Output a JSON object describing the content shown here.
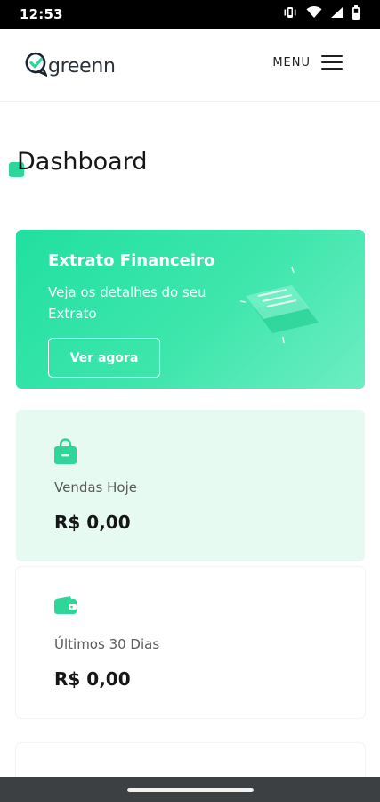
{
  "status_bar": {
    "time": "12:53",
    "icons": [
      "vibrate-icon",
      "wifi-icon",
      "signal-icon",
      "battery-icon"
    ]
  },
  "header": {
    "logo_text": "greenn",
    "menu_label": "MENU"
  },
  "page": {
    "title": "Dashboard"
  },
  "extrato": {
    "title": "Extrato Financeiro",
    "description": "Veja os detalhes do seu Extrato",
    "button_label": "Ver agora"
  },
  "stats": [
    {
      "label": "Vendas Hoje",
      "value": "R$ 0,00",
      "icon": "shopping-bag-icon"
    },
    {
      "label": "Últimos 30 Dias",
      "value": "R$ 0,00",
      "icon": "wallet-icon"
    }
  ],
  "colors": {
    "brand_green": "#2ed69a",
    "card_tint": "#e6faf2",
    "text_dark": "#161616"
  }
}
